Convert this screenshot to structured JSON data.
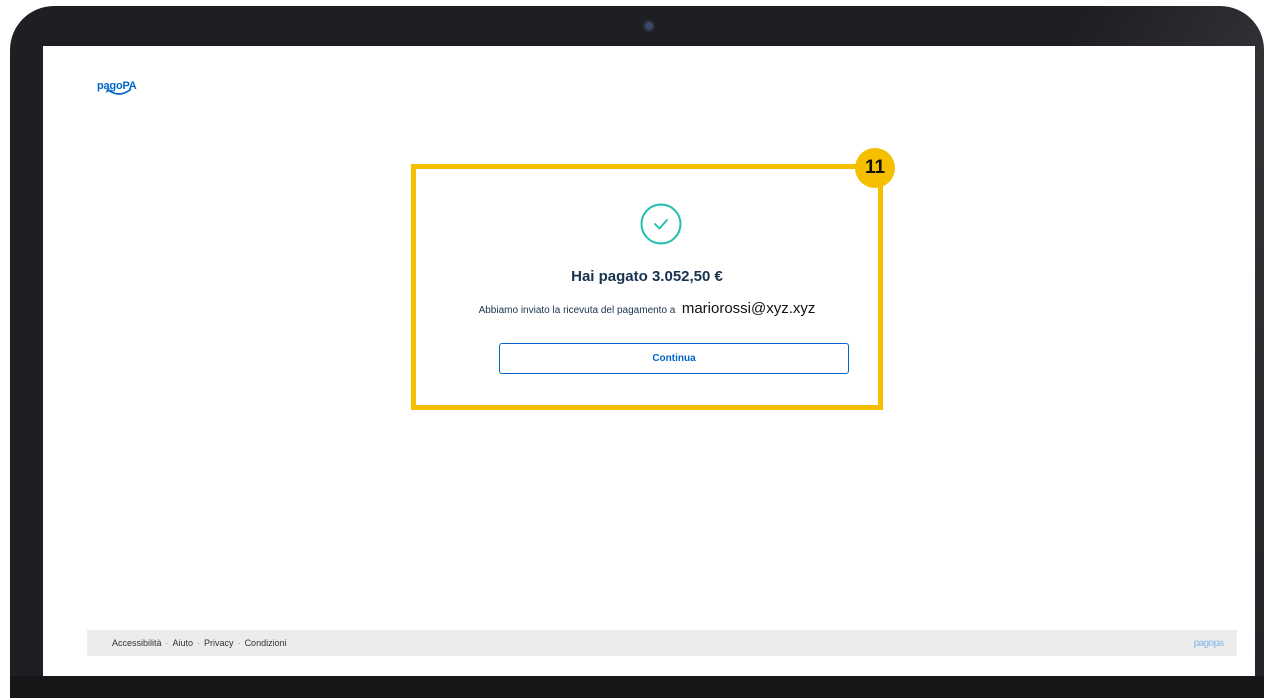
{
  "brand": {
    "logo_text": "pagoPA"
  },
  "result": {
    "title": "Hai pagato 3.052,50 €",
    "message": "Abbiamo inviato la ricevuta del pagamento a",
    "email": "mariorossi@xyz.xyz",
    "continue_label": "Continua",
    "success_color": "#1fbfad"
  },
  "annotation": {
    "step_number": "11",
    "color": "#f5bf00"
  },
  "footer": {
    "links": [
      "Accessibilità",
      "Aiuto",
      "Privacy",
      "Condizioni"
    ],
    "logo_text": "pagopa"
  },
  "icons": {
    "success": "check-circle-icon"
  }
}
